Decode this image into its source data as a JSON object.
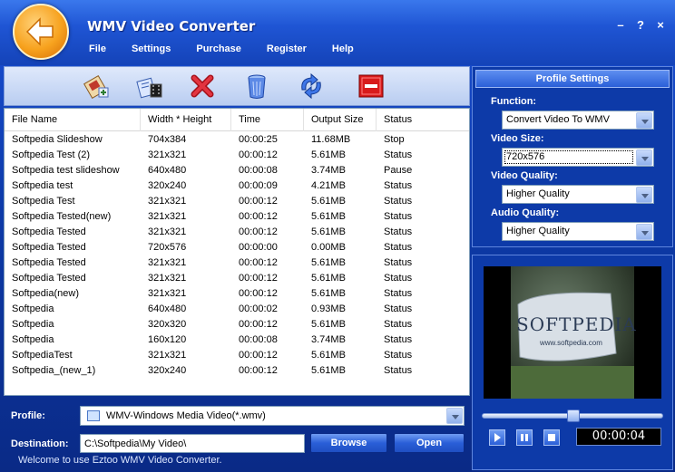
{
  "window": {
    "title": "WMV Video Converter",
    "buttons": [
      "–",
      "?",
      "×"
    ]
  },
  "menu": [
    "File",
    "Settings",
    "Purchase",
    "Register",
    "Help"
  ],
  "toolbar": [
    "add-file-icon",
    "add-folder-icon",
    "remove-icon",
    "clear-icon",
    "convert-icon",
    "stop-icon"
  ],
  "list": {
    "columns": [
      "File Name",
      "Width * Height",
      "Time",
      "Output Size",
      "Status"
    ],
    "rows": [
      [
        "Softpedia Slideshow",
        "704x384",
        "00:00:25",
        "11.68MB",
        "Stop"
      ],
      [
        "Softpedia Test (2)",
        "321x321",
        "00:00:12",
        "5.61MB",
        "Status"
      ],
      [
        "Softpedia test slideshow",
        "640x480",
        "00:00:08",
        "3.74MB",
        "Pause"
      ],
      [
        "Softpedia test",
        "320x240",
        "00:00:09",
        "4.21MB",
        "Status"
      ],
      [
        "Softpedia Test",
        "321x321",
        "00:00:12",
        "5.61MB",
        "Status"
      ],
      [
        "Softpedia Tested(new)",
        "321x321",
        "00:00:12",
        "5.61MB",
        "Status"
      ],
      [
        "Softpedia Tested",
        "321x321",
        "00:00:12",
        "5.61MB",
        "Status"
      ],
      [
        "Softpedia Tested",
        "720x576",
        "00:00:00",
        "0.00MB",
        "Status"
      ],
      [
        "Softpedia Tested",
        "321x321",
        "00:00:12",
        "5.61MB",
        "Status"
      ],
      [
        "Softpedia Tested",
        "321x321",
        "00:00:12",
        "5.61MB",
        "Status"
      ],
      [
        "Softpedia(new)",
        "321x321",
        "00:00:12",
        "5.61MB",
        "Status"
      ],
      [
        "Softpedia",
        "640x480",
        "00:00:02",
        "0.93MB",
        "Status"
      ],
      [
        "Softpedia",
        "320x320",
        "00:00:12",
        "5.61MB",
        "Status"
      ],
      [
        "Softpedia",
        "160x120",
        "00:00:08",
        "3.74MB",
        "Status"
      ],
      [
        "SoftpediaTest",
        "321x321",
        "00:00:12",
        "5.61MB",
        "Status"
      ],
      [
        "Softpedia_(new_1)",
        "320x240",
        "00:00:12",
        "5.61MB",
        "Status"
      ]
    ]
  },
  "profile": {
    "label": "Profile:",
    "value": "WMV-Windows Media Video(*.wmv)"
  },
  "destination": {
    "label": "Destination:",
    "value": "C:\\Softpedia\\My Video\\"
  },
  "buttons": {
    "browse": "Browse",
    "open": "Open"
  },
  "status_text": "Welcome to use Eztoo WMV Video Converter.",
  "settings": {
    "header": "Profile Settings",
    "function_label": "Function:",
    "function_value": "Convert Video To WMV",
    "size_label": "Video Size:",
    "size_value": "720x576",
    "vquality_label": "Video Quality:",
    "vquality_value": "Higher Quality",
    "aquality_label": "Audio Quality:",
    "aquality_value": "Higher Quality"
  },
  "player": {
    "time": "00:00:04",
    "preview_text": "SOFTPEDIA",
    "preview_url": "www.softpedia.com",
    "seek_position": 0.5
  }
}
